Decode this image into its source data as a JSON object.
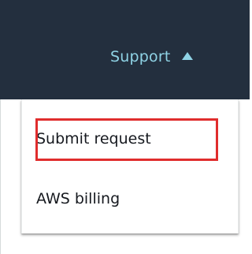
{
  "header": {
    "support_label": "Support"
  },
  "support_menu": {
    "items": [
      {
        "label": "Submit request"
      },
      {
        "label": "AWS billing"
      }
    ]
  },
  "colors": {
    "topbar_background": "#232f3e",
    "support_link": "#8fd3e5",
    "highlight_box": "#e02d2d"
  }
}
